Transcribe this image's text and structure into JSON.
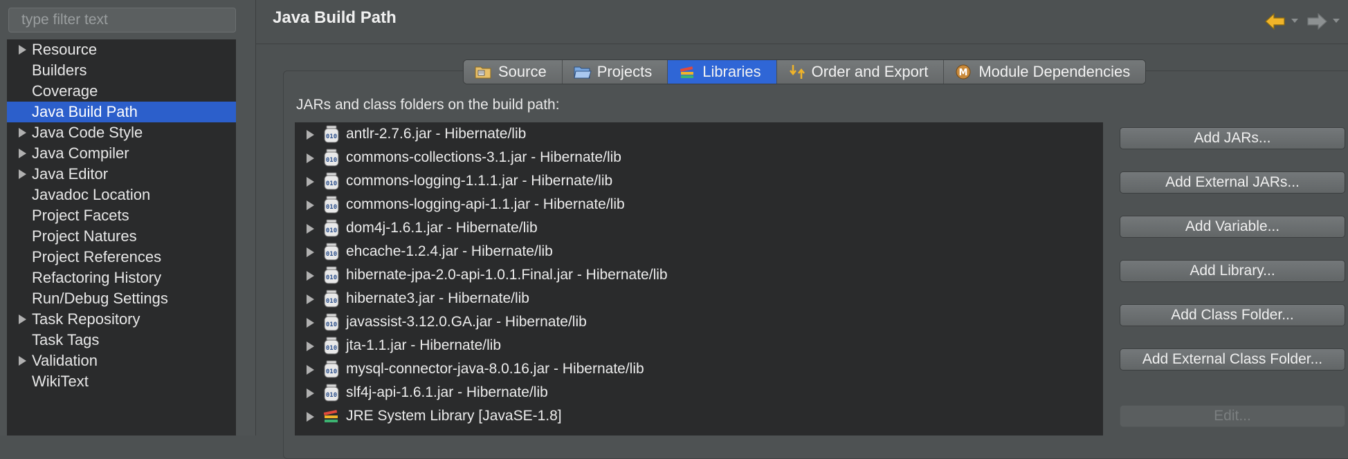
{
  "filter": {
    "placeholder": "type filter text"
  },
  "sidebar": {
    "items": [
      {
        "label": "Resource",
        "expandable": true
      },
      {
        "label": "Builders",
        "expandable": false
      },
      {
        "label": "Coverage",
        "expandable": false
      },
      {
        "label": "Java Build Path",
        "expandable": false,
        "selected": true
      },
      {
        "label": "Java Code Style",
        "expandable": true
      },
      {
        "label": "Java Compiler",
        "expandable": true
      },
      {
        "label": "Java Editor",
        "expandable": true
      },
      {
        "label": "Javadoc Location",
        "expandable": false
      },
      {
        "label": "Project Facets",
        "expandable": false
      },
      {
        "label": "Project Natures",
        "expandable": false
      },
      {
        "label": "Project References",
        "expandable": false
      },
      {
        "label": "Refactoring History",
        "expandable": false
      },
      {
        "label": "Run/Debug Settings",
        "expandable": false
      },
      {
        "label": "Task Repository",
        "expandable": true
      },
      {
        "label": "Task Tags",
        "expandable": false
      },
      {
        "label": "Validation",
        "expandable": true
      },
      {
        "label": "WikiText",
        "expandable": false
      }
    ]
  },
  "header": {
    "title": "Java Build Path"
  },
  "tabs": [
    {
      "label": "Source",
      "icon": "source-folder-icon"
    },
    {
      "label": "Projects",
      "icon": "projects-folder-icon"
    },
    {
      "label": "Libraries",
      "icon": "libraries-icon",
      "active": true
    },
    {
      "label": "Order and Export",
      "icon": "order-export-icon"
    },
    {
      "label": "Module Dependencies",
      "icon": "module-icon"
    }
  ],
  "libraries": {
    "caption": "JARs and class folders on the build path:",
    "items": [
      {
        "label": "antlr-2.7.6.jar - Hibernate/lib",
        "icon": "jar-icon"
      },
      {
        "label": "commons-collections-3.1.jar - Hibernate/lib",
        "icon": "jar-icon"
      },
      {
        "label": "commons-logging-1.1.1.jar - Hibernate/lib",
        "icon": "jar-icon"
      },
      {
        "label": "commons-logging-api-1.1.jar - Hibernate/lib",
        "icon": "jar-icon"
      },
      {
        "label": "dom4j-1.6.1.jar - Hibernate/lib",
        "icon": "jar-icon"
      },
      {
        "label": "ehcache-1.2.4.jar - Hibernate/lib",
        "icon": "jar-icon"
      },
      {
        "label": "hibernate-jpa-2.0-api-1.0.1.Final.jar - Hibernate/lib",
        "icon": "jar-icon"
      },
      {
        "label": "hibernate3.jar - Hibernate/lib",
        "icon": "jar-icon"
      },
      {
        "label": "javassist-3.12.0.GA.jar - Hibernate/lib",
        "icon": "jar-icon"
      },
      {
        "label": "jta-1.1.jar - Hibernate/lib",
        "icon": "jar-icon"
      },
      {
        "label": "mysql-connector-java-8.0.16.jar - Hibernate/lib",
        "icon": "jar-icon"
      },
      {
        "label": "slf4j-api-1.6.1.jar - Hibernate/lib",
        "icon": "jar-icon"
      },
      {
        "label": "JRE System Library [JavaSE-1.8]",
        "icon": "library-books-icon"
      }
    ]
  },
  "buttons": {
    "add_jars": "Add JARs...",
    "add_external_jars": "Add External JARs...",
    "add_variable": "Add Variable...",
    "add_library": "Add Library...",
    "add_class_folder": "Add Class Folder...",
    "add_external_class_folder": "Add External Class Folder...",
    "edit": "Edit..."
  },
  "colors": {
    "selection": "#2c5fcb",
    "active_tab": "#2f66d6",
    "list_bg": "#2a2b2c",
    "pane_bg": "#4d5152"
  }
}
